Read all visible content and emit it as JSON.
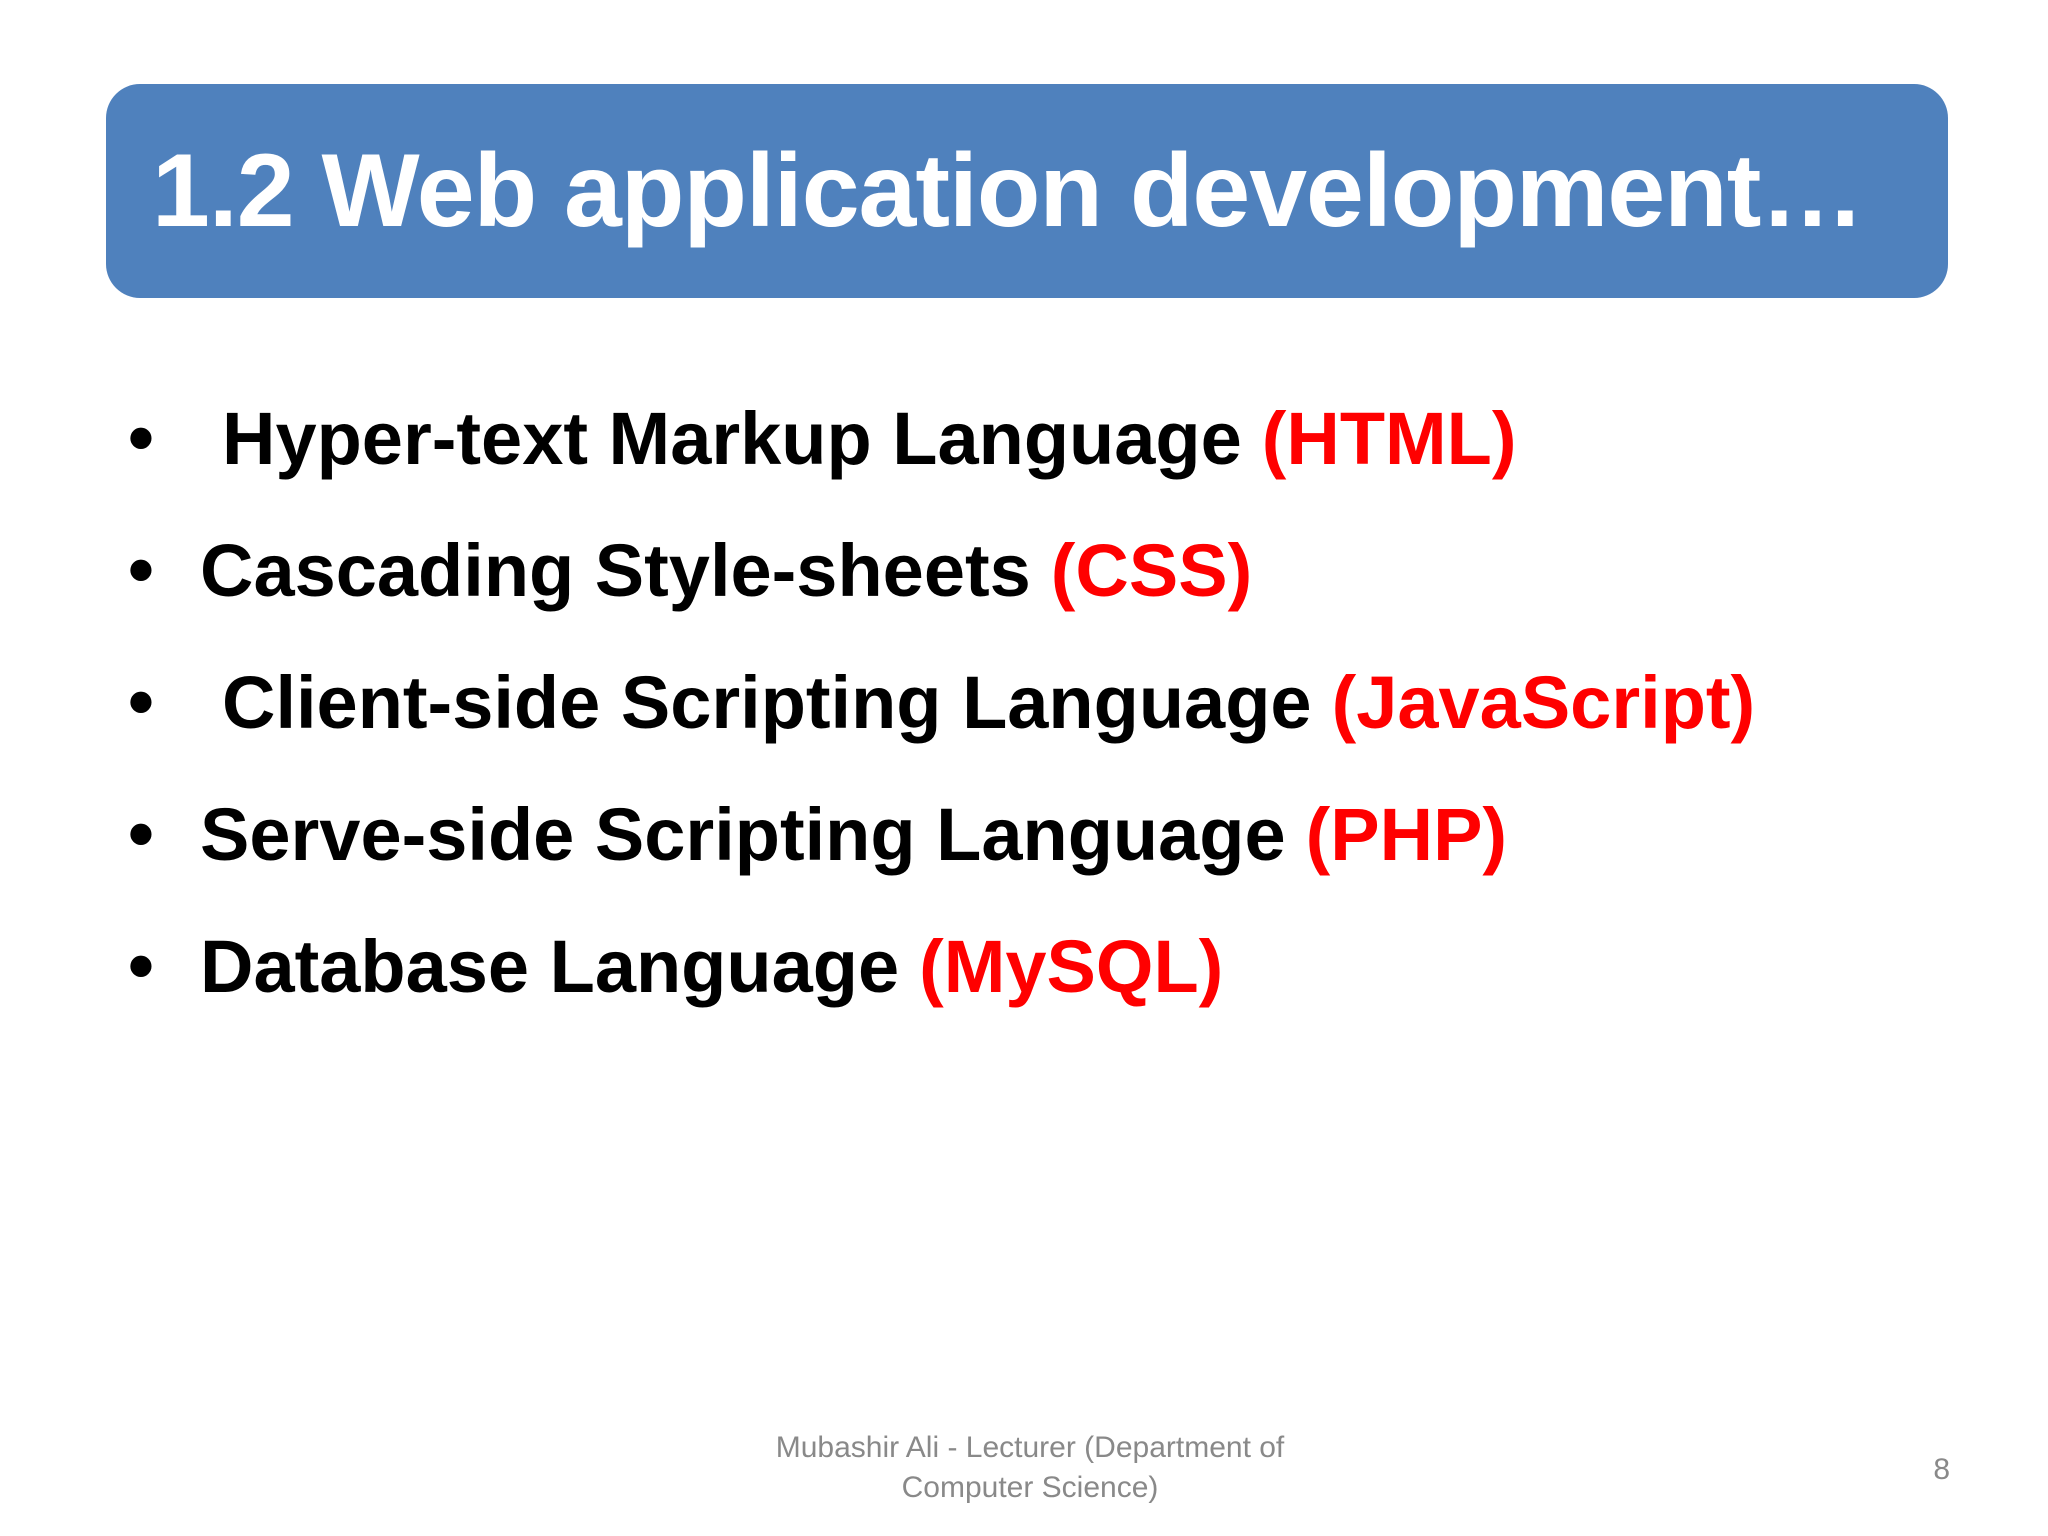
{
  "title": "1.2 Web application development…",
  "bullets": [
    {
      "main": "Hyper-text Markup Language",
      "abbr": "(HTML)"
    },
    {
      "main": "Cascading Style-sheets",
      "abbr": "(CSS)"
    },
    {
      "main": "Client-side Scripting Language",
      "abbr": "(JavaScript)"
    },
    {
      "main": "Serve-side Scripting Language",
      "abbr": "(PHP)"
    },
    {
      "main": "Database Language",
      "abbr": "(MySQL)"
    }
  ],
  "footer": {
    "line1": "Mubashir Ali - Lecturer (Department of",
    "line2": "Computer Science)"
  },
  "slide_number": "8",
  "colors": {
    "title_background": "#4f81bd",
    "highlight": "#ff0000",
    "footer_text": "#898989"
  }
}
